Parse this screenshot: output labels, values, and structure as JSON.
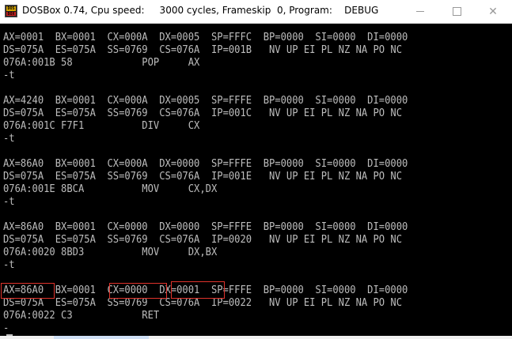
{
  "window": {
    "title": "DOSBox 0.74, Cpu speed:     3000 cycles, Frameskip  0, Program:    DEBUG",
    "icon_label_top": "DOS",
    "icon_label_bottom": "BOX",
    "minimize_icon": "minimize-icon",
    "maximize_icon": "maximize-icon",
    "close_icon": "close-icon",
    "close_glyph": "✕"
  },
  "console": {
    "lines": [
      "AX=0001  BX=0001  CX=000A  DX=0005  SP=FFFC  BP=0000  SI=0000  DI=0000",
      "DS=075A  ES=075A  SS=0769  CS=076A  IP=001B   NV UP EI PL NZ NA PO NC",
      "076A:001B 58            POP     AX",
      "-t",
      "",
      "AX=4240  BX=0001  CX=000A  DX=0005  SP=FFFE  BP=0000  SI=0000  DI=0000",
      "DS=075A  ES=075A  SS=0769  CS=076A  IP=001C   NV UP EI PL NZ NA PO NC",
      "076A:001C F7F1          DIV     CX",
      "-t",
      "",
      "AX=86A0  BX=0001  CX=000A  DX=0000  SP=FFFE  BP=0000  SI=0000  DI=0000",
      "DS=075A  ES=075A  SS=0769  CS=076A  IP=001E   NV UP EI PL NZ NA PO NC",
      "076A:001E 8BCA          MOV     CX,DX",
      "-t",
      "",
      "AX=86A0  BX=0001  CX=0000  DX=0000  SP=FFFE  BP=0000  SI=0000  DI=0000",
      "DS=075A  ES=075A  SS=0769  CS=076A  IP=0020   NV UP EI PL NZ NA PO NC",
      "076A:0020 8BD3          MOV     DX,BX",
      "-t",
      "",
      "AX=86A0  BX=0001  CX=0000  DX=0001  SP=FFFE  BP=0000  SI=0000  DI=0000",
      "DS=075A  ES=075A  SS=0769  CS=076A  IP=0022   NV UP EI PL NZ NA PO NC",
      "076A:0022 C3            RET",
      "-"
    ],
    "text_color": "#bdbdbd",
    "background": "#000000",
    "highlight_color": "#e0332b",
    "highlighted_registers": [
      "AX=86A0",
      "CX=0000",
      "DX=0001"
    ]
  }
}
